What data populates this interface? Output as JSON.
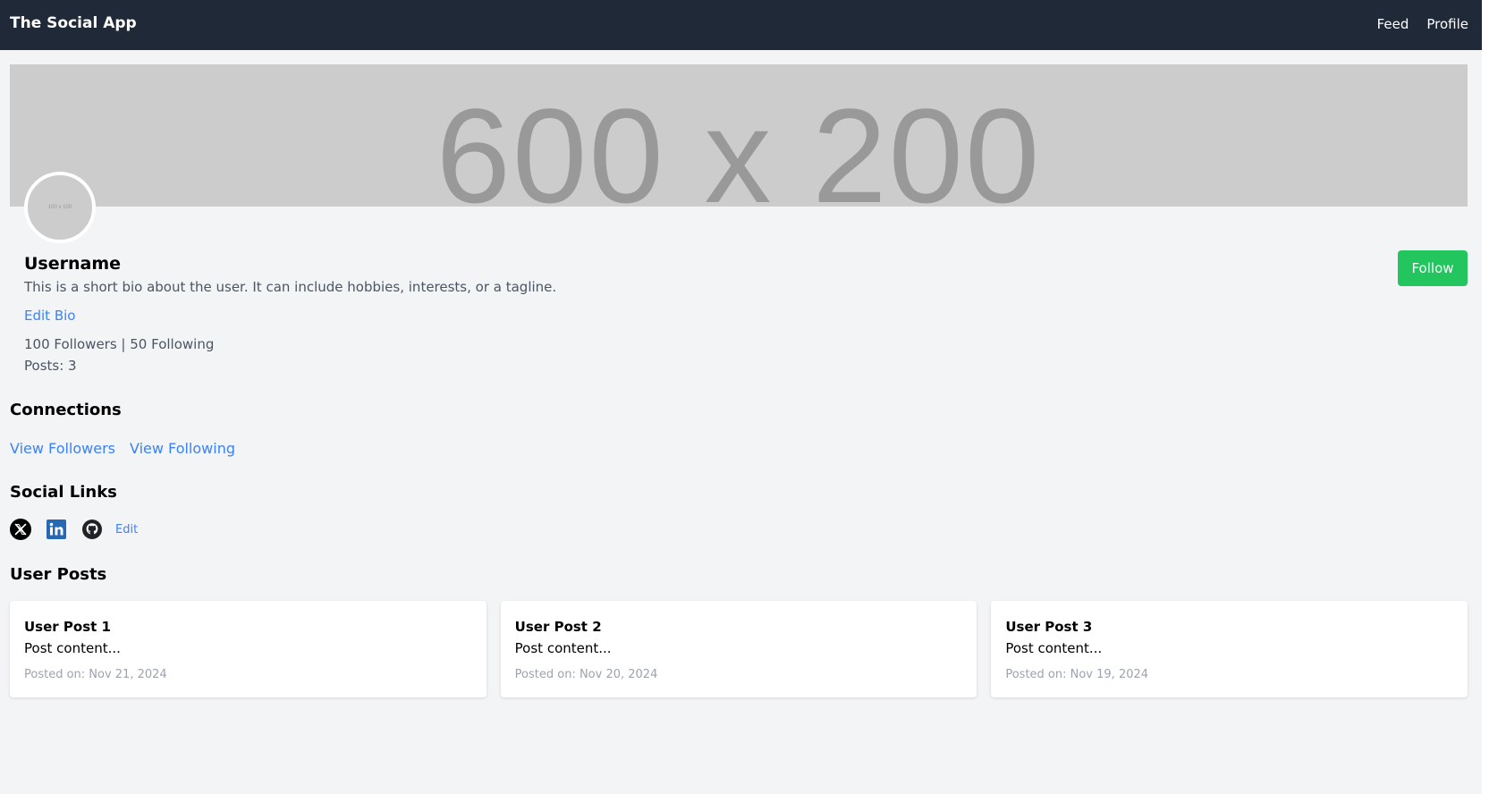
{
  "nav": {
    "brand": "The Social App",
    "links": [
      "Feed",
      "Profile"
    ]
  },
  "cover": {
    "placeholder": "600 x 200"
  },
  "avatar": {
    "placeholder": "100 x 100"
  },
  "profile": {
    "username": "Username",
    "bio": "This is a short bio about the user. It can include hobbies, interests, or a tagline.",
    "edit_bio": "Edit Bio",
    "follow_counts": "100 Followers | 50 Following",
    "posts_count": "Posts: 3",
    "follow_button": "Follow"
  },
  "connections": {
    "title": "Connections",
    "view_followers": "View Followers",
    "view_following": "View Following"
  },
  "social": {
    "title": "Social Links",
    "icons": [
      "x-icon",
      "linkedin-icon",
      "github-icon"
    ],
    "edit": "Edit"
  },
  "posts": {
    "title": "User Posts",
    "items": [
      {
        "title": "User Post 1",
        "content": "Post content...",
        "date": "Posted on: Nov 21, 2024"
      },
      {
        "title": "User Post 2",
        "content": "Post content...",
        "date": "Posted on: Nov 20, 2024"
      },
      {
        "title": "User Post 3",
        "content": "Post content...",
        "date": "Posted on: Nov 19, 2024"
      }
    ]
  },
  "colors": {
    "nav_bg": "#1f2937",
    "page_bg": "#f3f4f6",
    "link": "#3b82f6",
    "follow": "#22c55e",
    "placeholder_bg": "#cccccc",
    "placeholder_text": "#999999"
  }
}
